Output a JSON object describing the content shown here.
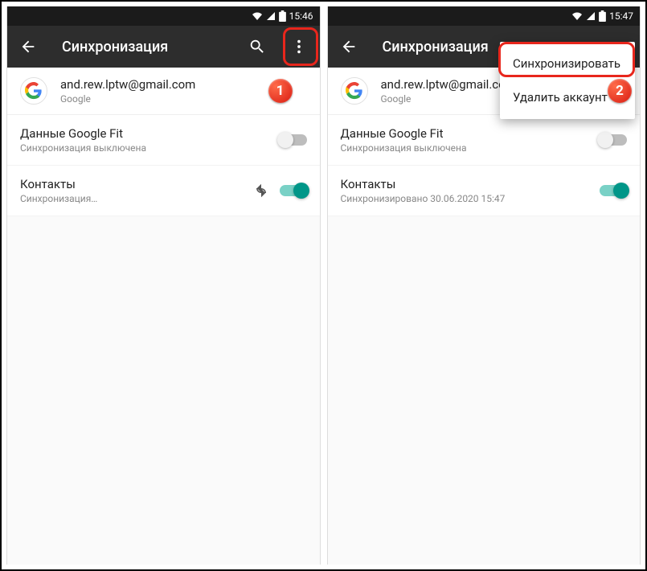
{
  "left": {
    "status": {
      "time": "15:46"
    },
    "appbar": {
      "title": "Синхронизация"
    },
    "account": {
      "email": "and.rew.lptw@gmail.com",
      "provider": "Google"
    },
    "items": [
      {
        "title": "Данные Google Fit",
        "subtitle": "Синхронизация выключена",
        "on": false,
        "syncing": false
      },
      {
        "title": "Контакты",
        "subtitle": "Синхронизация…",
        "on": true,
        "syncing": true
      }
    ],
    "badge": "1"
  },
  "right": {
    "status": {
      "time": "15:47"
    },
    "appbar": {
      "title": "Синхронизация"
    },
    "account": {
      "email": "and.rew.lptw@gmail.com",
      "provider": "Google"
    },
    "items": [
      {
        "title": "Данные Google Fit",
        "subtitle": "Синхронизация выключена",
        "on": false,
        "syncing": false
      },
      {
        "title": "Контакты",
        "subtitle": "Синхронизировано 30.06.2020 15:47",
        "on": true,
        "syncing": false
      }
    ],
    "menu": {
      "sync_now": "Синхронизировать",
      "delete_account": "Удалить аккаунт"
    },
    "badge": "2"
  }
}
